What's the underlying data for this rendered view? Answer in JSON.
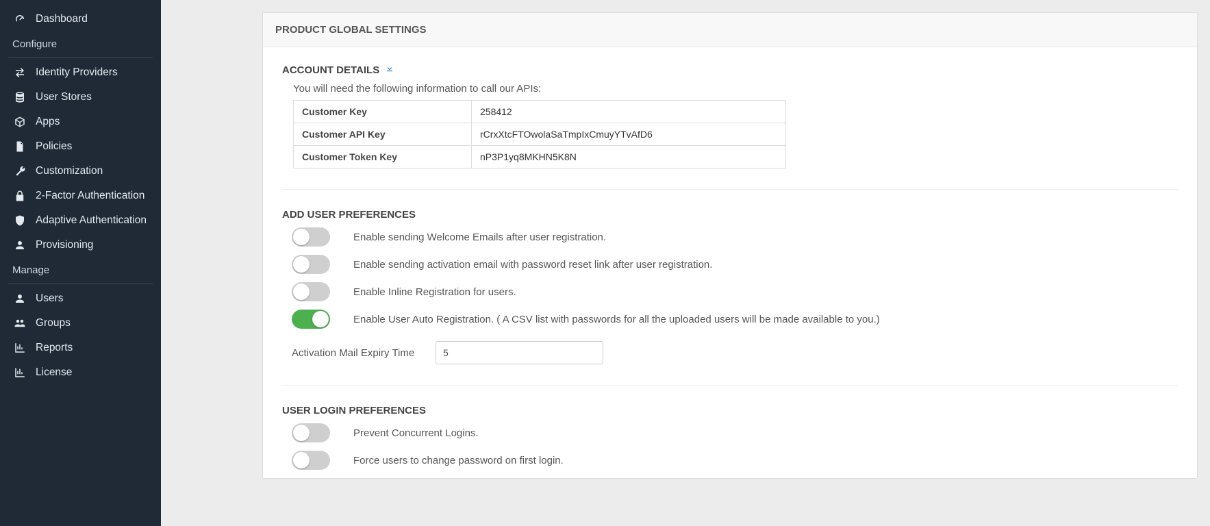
{
  "sidebar": {
    "top": [
      {
        "label": "Dashboard",
        "icon": "gauge"
      }
    ],
    "sections": [
      {
        "header": "Configure",
        "items": [
          {
            "label": "Identity Providers",
            "icon": "exchange"
          },
          {
            "label": "User Stores",
            "icon": "database"
          },
          {
            "label": "Apps",
            "icon": "cube"
          },
          {
            "label": "Policies",
            "icon": "document"
          },
          {
            "label": "Customization",
            "icon": "wrench"
          },
          {
            "label": "2-Factor Authentication",
            "icon": "lock"
          },
          {
            "label": "Adaptive Authentication",
            "icon": "shield"
          },
          {
            "label": "Provisioning",
            "icon": "user"
          }
        ]
      },
      {
        "header": "Manage",
        "items": [
          {
            "label": "Users",
            "icon": "user"
          },
          {
            "label": "Groups",
            "icon": "users"
          },
          {
            "label": "Reports",
            "icon": "chart"
          },
          {
            "label": "License",
            "icon": "chart"
          }
        ]
      }
    ]
  },
  "panel": {
    "title": "PRODUCT GLOBAL SETTINGS"
  },
  "account": {
    "title": "ACCOUNT DETAILS",
    "desc": "You will need the following information to call our APIs:",
    "rows": [
      {
        "k": "Customer Key",
        "v": "258412"
      },
      {
        "k": "Customer API Key",
        "v": "rCrxXtcFTOwolaSaTmpIxCmuyYTvAfD6"
      },
      {
        "k": "Customer Token Key",
        "v": "nP3P1yq8MKHN5K8N"
      }
    ]
  },
  "addUser": {
    "title": "ADD USER PREFERENCES",
    "prefs": [
      {
        "label": "Enable sending Welcome Emails after user registration.",
        "on": false
      },
      {
        "label": "Enable sending activation email with password reset link after user registration.",
        "on": false
      },
      {
        "label": "Enable Inline Registration for users.",
        "on": false
      },
      {
        "label": "Enable User Auto Registration. ( A CSV list with passwords for all the uploaded users will be made available to you.)",
        "on": true
      }
    ],
    "expiry": {
      "label": "Activation Mail Expiry Time",
      "value": "5"
    }
  },
  "login": {
    "title": "USER LOGIN PREFERENCES",
    "prefs": [
      {
        "label": "Prevent Concurrent Logins.",
        "on": false
      },
      {
        "label": "Force users to change password on first login.",
        "on": false
      }
    ]
  }
}
